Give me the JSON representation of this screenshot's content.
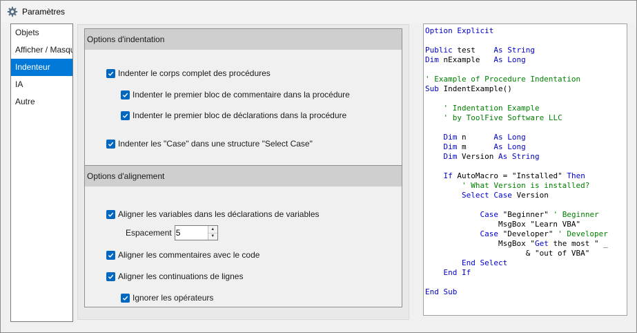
{
  "window": {
    "title": "Paramètres",
    "icon": "gear-icon"
  },
  "nav": {
    "items": [
      {
        "label": "Objets",
        "selected": false
      },
      {
        "label": "Afficher / Masquer",
        "selected": false
      },
      {
        "label": "Indenteur",
        "selected": true
      },
      {
        "label": "IA",
        "selected": false
      },
      {
        "label": "Autre",
        "selected": false
      }
    ]
  },
  "indentation": {
    "header": "Options d'indentation",
    "options": [
      {
        "label": "Indenter le corps complet des procédures",
        "checked": true
      },
      {
        "label": "Indenter le premier bloc de commentaire dans la procédure",
        "checked": true
      },
      {
        "label": "Indenter le premier bloc de déclarations dans la procédure",
        "checked": true
      },
      {
        "label": "Indenter les \"Case\" dans une structure \"Select Case\"",
        "checked": true
      }
    ]
  },
  "alignment": {
    "header": "Options d'alignement",
    "options": [
      {
        "label": "Aligner les variables dans les déclarations de variables",
        "checked": true
      },
      {
        "label": "Aligner les commentaires avec le code",
        "checked": true
      },
      {
        "label": "Aligner les continuations de lignes",
        "checked": true
      },
      {
        "label": "Ignorer les opérateurs",
        "checked": true
      }
    ],
    "spacing": {
      "label": "Espacement",
      "value": "5"
    }
  },
  "colors": {
    "accent": "#0078d7",
    "checkbox": "#0067c0",
    "keyword": "#0000c8",
    "comment": "#008000"
  },
  "code_preview": {
    "lines": [
      [
        [
          "kw",
          "Option Explicit"
        ]
      ],
      [],
      [
        [
          "kw",
          "Public"
        ],
        [
          "tx",
          " test    "
        ],
        [
          "kw",
          "As String"
        ]
      ],
      [
        [
          "kw",
          "Dim"
        ],
        [
          "tx",
          " nExample   "
        ],
        [
          "kw",
          "As Long"
        ]
      ],
      [],
      [
        [
          "cm",
          "' Example of Procedure Indentation"
        ]
      ],
      [
        [
          "kw",
          "Sub"
        ],
        [
          "tx",
          " IndentExample()"
        ]
      ],
      [],
      [
        [
          "tx",
          "    "
        ],
        [
          "cm",
          "' Indentation Example"
        ]
      ],
      [
        [
          "tx",
          "    "
        ],
        [
          "cm",
          "' by ToolFive Software LLC"
        ]
      ],
      [],
      [
        [
          "tx",
          "    "
        ],
        [
          "kw",
          "Dim"
        ],
        [
          "tx",
          " n      "
        ],
        [
          "kw",
          "As Long"
        ]
      ],
      [
        [
          "tx",
          "    "
        ],
        [
          "kw",
          "Dim"
        ],
        [
          "tx",
          " m      "
        ],
        [
          "kw",
          "As Long"
        ]
      ],
      [
        [
          "tx",
          "    "
        ],
        [
          "kw",
          "Dim"
        ],
        [
          "tx",
          " Version "
        ],
        [
          "kw",
          "As String"
        ]
      ],
      [],
      [
        [
          "tx",
          "    "
        ],
        [
          "kw",
          "If"
        ],
        [
          "tx",
          " AutoMacro = \"Installed\" "
        ],
        [
          "kw",
          "Then"
        ]
      ],
      [
        [
          "tx",
          "        "
        ],
        [
          "cm",
          "' What Version is installed?"
        ]
      ],
      [
        [
          "tx",
          "        "
        ],
        [
          "kw",
          "Select Case"
        ],
        [
          "tx",
          " Version"
        ]
      ],
      [],
      [
        [
          "tx",
          "            "
        ],
        [
          "kw",
          "Case"
        ],
        [
          "tx",
          " \"Beginner\" "
        ],
        [
          "cm",
          "' Beginner"
        ]
      ],
      [
        [
          "tx",
          "                MsgBox \"Learn VBA\""
        ]
      ],
      [
        [
          "tx",
          "            "
        ],
        [
          "kw",
          "Case"
        ],
        [
          "tx",
          " \"Developer\" "
        ],
        [
          "cm",
          "' Developer"
        ]
      ],
      [
        [
          "tx",
          "                MsgBox \""
        ],
        [
          "kw",
          "Get"
        ],
        [
          "tx",
          " the most \" _"
        ]
      ],
      [
        [
          "tx",
          "                      & \"out of VBA\""
        ]
      ],
      [
        [
          "tx",
          "        "
        ],
        [
          "kw",
          "End Select"
        ]
      ],
      [
        [
          "tx",
          "    "
        ],
        [
          "kw",
          "End If"
        ]
      ],
      [],
      [
        [
          "kw",
          "End Sub"
        ]
      ]
    ]
  }
}
